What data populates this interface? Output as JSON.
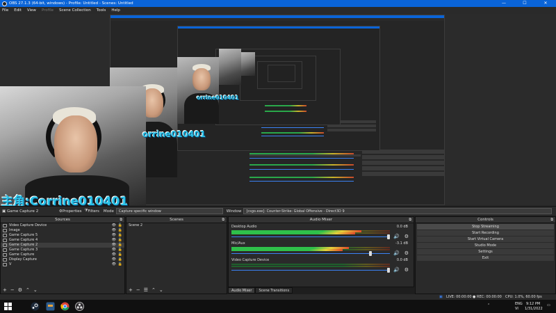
{
  "window": {
    "title": "OBS 27.1.3 (64-bit, windows) - Profile: Untitled - Scenes: Untitled",
    "minimize": "—",
    "maximize": "☐",
    "close": "✕"
  },
  "menu": [
    "File",
    "Edit",
    "View",
    "Profile",
    "Scene Collection",
    "Tools",
    "Help"
  ],
  "preview": {
    "overlay_text": "主角:Corrine010401",
    "overlay_text_mid": "orrine010401"
  },
  "source_toolbar": {
    "source_name": "Game Capture 2",
    "properties": "Properties",
    "filters": "Filters",
    "mode_label": "Mode",
    "mode_value": "Capture specific window",
    "window_label": "Window",
    "window_value": "[csgo.exe]: Counter-Strike: Global Offensive - Direct3D 9"
  },
  "sources": {
    "header": "Sources",
    "items": [
      {
        "label": "Video Capture Device",
        "icon": "camera-icon",
        "locked": false
      },
      {
        "label": "Image",
        "icon": "image-icon",
        "locked": false
      },
      {
        "label": "Game Capture 5",
        "icon": "gamepad-icon",
        "locked": false
      },
      {
        "label": "Game Capture 4",
        "icon": "gamepad-icon",
        "locked": false
      },
      {
        "label": "Game Capture 2",
        "icon": "gamepad-icon",
        "locked": false
      },
      {
        "label": "Game Capture 3",
        "icon": "gamepad-icon",
        "locked": false
      },
      {
        "label": "Game Capture",
        "icon": "gamepad-icon",
        "locked": false
      },
      {
        "label": "Display Capture",
        "icon": "monitor-icon",
        "locked": true
      },
      {
        "label": "V",
        "icon": "text-icon",
        "locked": false
      }
    ]
  },
  "scenes": {
    "header": "Scenes",
    "items": [
      "Scene 2"
    ]
  },
  "mixer": {
    "header": "Audio Mixer",
    "channels": [
      {
        "name": "Desktop Audio",
        "db": "0.0 dB",
        "level": 0.82,
        "fader": 0.98
      },
      {
        "name": "Mic/Aux",
        "db": "-3.1 dB",
        "level": 0.74,
        "fader": 0.88
      },
      {
        "name": "Video Capture Device",
        "db": "0.0 dB",
        "level": 0.0,
        "fader": 0.98
      }
    ],
    "tabs": [
      "Audio Mixer",
      "Scene Transitions"
    ]
  },
  "controls": {
    "header": "Controls",
    "buttons": [
      "Stop Streaming",
      "Start Recording",
      "Start Virtual Camera",
      "Studio Mode",
      "Settings",
      "Exit"
    ]
  },
  "status": {
    "live": "LIVE: 00:00:00",
    "rec": "REC: 00:00:00",
    "cpu": "CPU: 1.0%, 60.00 fps"
  },
  "taskbar": {
    "lang": "ENG",
    "lang_sub": "VI",
    "time": "9:12 PM",
    "date": "1/31/2022"
  },
  "colors": {
    "title_bar": "#0a64d8",
    "overlay_text": "#2ac3e8",
    "fader": "#3b82f6"
  }
}
